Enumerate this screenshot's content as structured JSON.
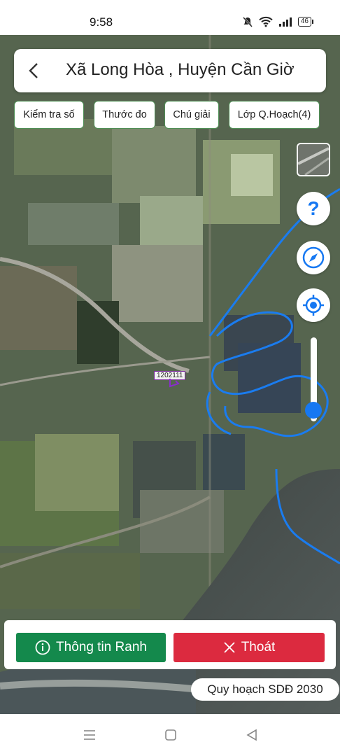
{
  "status_bar": {
    "time": "9:58",
    "battery_label": "46",
    "icons": [
      "mute-icon",
      "wifi-icon",
      "signal-icon",
      "battery-icon"
    ]
  },
  "header": {
    "title": "Xã Long Hòa , Huyện Cần Giờ"
  },
  "toolbar": {
    "check_number": "Kiểm tra số",
    "ruler": "Thước đo",
    "legend": "Chú giải",
    "planning_layers": "Lớp Q.Hoạch(4)"
  },
  "map": {
    "parcel_label": "1202111",
    "zoom_level": 0.15,
    "accent": "#1678f2",
    "river_color": "#1a7cf0",
    "parcel_color": "#8a2ccf"
  },
  "actions": {
    "info_label": "Thông tin Ranh",
    "exit_label": "Thoát",
    "info_color": "#14894c",
    "exit_color": "#dc2a3f"
  },
  "plan_badge": "Quy hoạch SDĐ 2030",
  "nav": {
    "icons": [
      "menu-icon",
      "home-icon",
      "back-nav-icon"
    ]
  }
}
